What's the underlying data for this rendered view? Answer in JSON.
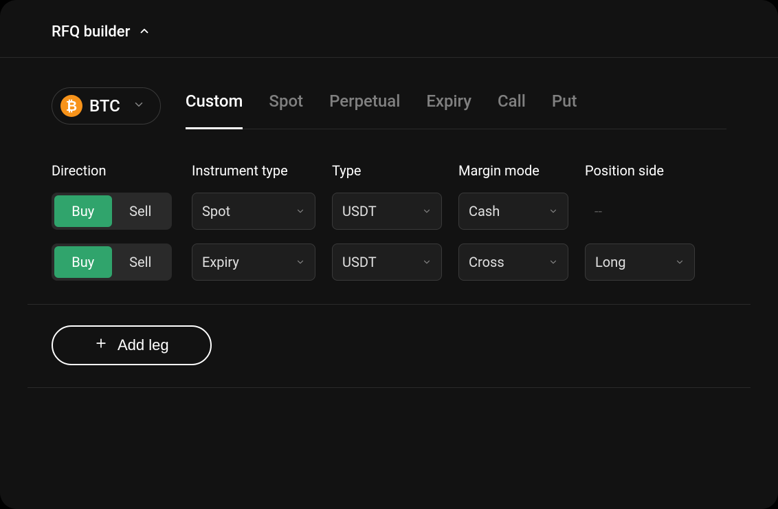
{
  "header": {
    "title": "RFQ builder"
  },
  "asset": {
    "symbol": "BTC",
    "icon_glyph": "₿"
  },
  "tabs": [
    {
      "label": "Custom",
      "active": true
    },
    {
      "label": "Spot",
      "active": false
    },
    {
      "label": "Perpetual",
      "active": false
    },
    {
      "label": "Expiry",
      "active": false
    },
    {
      "label": "Call",
      "active": false
    },
    {
      "label": "Put",
      "active": false
    }
  ],
  "columns": {
    "direction": "Direction",
    "instrument_type": "Instrument type",
    "type": "Type",
    "margin_mode": "Margin mode",
    "position_side": "Position side"
  },
  "direction_labels": {
    "buy": "Buy",
    "sell": "Sell"
  },
  "legs": [
    {
      "direction": "buy",
      "instrument_type": "Spot",
      "type": "USDT",
      "margin_mode": "Cash",
      "position_side": "--",
      "position_side_empty": true
    },
    {
      "direction": "buy",
      "instrument_type": "Expiry",
      "type": "USDT",
      "margin_mode": "Cross",
      "position_side": "Long",
      "position_side_empty": false
    }
  ],
  "add_leg_label": "Add leg",
  "colors": {
    "accent_green": "#30a46c",
    "btc_orange": "#f7931a"
  }
}
